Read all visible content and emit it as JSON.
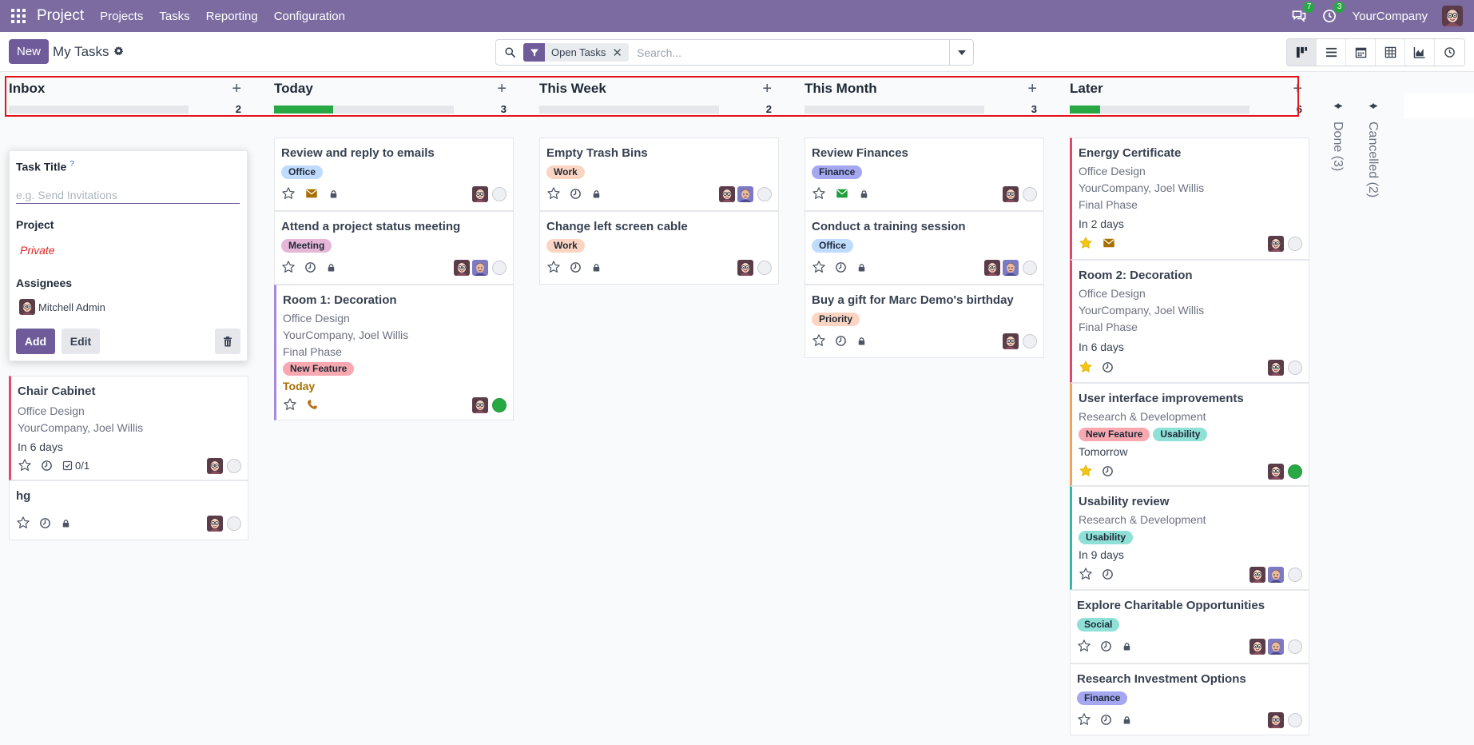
{
  "navbar": {
    "brand": "Project",
    "menu": [
      "Projects",
      "Tasks",
      "Reporting",
      "Configuration"
    ],
    "messages_badge": "7",
    "activities_badge": "3",
    "company": "YourCompany"
  },
  "control": {
    "new_label": "New",
    "breadcrumb": "My Tasks",
    "facet": "Open Tasks",
    "search_placeholder": "Search..."
  },
  "columns": [
    {
      "title": "Inbox",
      "count": "2",
      "progress": 0
    },
    {
      "title": "Today",
      "count": "3",
      "progress": 0.33
    },
    {
      "title": "This Week",
      "count": "2",
      "progress": 0
    },
    {
      "title": "This Month",
      "count": "3",
      "progress": 0
    },
    {
      "title": "Later",
      "count": "6",
      "progress": 0.17
    }
  ],
  "folded": [
    {
      "label": "Done (3)"
    },
    {
      "label": "Cancelled (2)"
    }
  ],
  "quick_create": {
    "task_title_label": "Task Title",
    "help_mark": "?",
    "title_placeholder": "e.g. Send Invitations",
    "project_label": "Project",
    "project_value": "Private",
    "assignees_label": "Assignees",
    "assignee": "Mitchell Admin",
    "add": "Add",
    "edit": "Edit"
  },
  "cards": {
    "inbox": [
      {
        "title": "Chair Cabinet",
        "project": "Office Design",
        "partner": "YourCompany, Joel Willis",
        "date": "In 6 days",
        "subtasks": "0/1"
      },
      {
        "title": "hg"
      }
    ],
    "today": [
      {
        "title": "Review and reply to emails",
        "tags": [
          {
            "name": "Office",
            "color": "#bfdbfe"
          }
        ]
      },
      {
        "title": "Attend a project status meeting",
        "tags": [
          {
            "name": "Meeting",
            "color": "#e6b6d8"
          }
        ]
      },
      {
        "title": "Room 1: Decoration",
        "project": "Office Design",
        "partner": "YourCompany, Joel Willis",
        "stage": "Final Phase",
        "tags": [
          {
            "name": "New Feature",
            "color": "#f9a8b0"
          }
        ],
        "date": "Today"
      }
    ],
    "week": [
      {
        "title": "Empty Trash Bins",
        "tags": [
          {
            "name": "Work",
            "color": "#fcd5c2"
          }
        ]
      },
      {
        "title": "Change left screen cable",
        "tags": [
          {
            "name": "Work",
            "color": "#fcd5c2"
          }
        ]
      }
    ],
    "month": [
      {
        "title": "Review Finances",
        "tags": [
          {
            "name": "Finance",
            "color": "#a5a8f0"
          }
        ]
      },
      {
        "title": "Conduct a training session",
        "tags": [
          {
            "name": "Office",
            "color": "#bfdbfe"
          }
        ]
      },
      {
        "title": "Buy a gift for Marc Demo's birthday",
        "tags": [
          {
            "name": "Priority",
            "color": "#fcd5c2"
          }
        ]
      }
    ],
    "later": [
      {
        "title": "Energy Certificate",
        "project": "Office Design",
        "partner": "YourCompany, Joel Willis",
        "stage": "Final Phase",
        "date": "In 2 days"
      },
      {
        "title": "Room 2: Decoration",
        "project": "Office Design",
        "partner": "YourCompany, Joel Willis",
        "stage": "Final Phase",
        "date": "In 6 days"
      },
      {
        "title": "User interface improvements",
        "project": "Research & Development",
        "tags": [
          {
            "name": "New Feature",
            "color": "#f9a8b0"
          },
          {
            "name": "Usability",
            "color": "#8fe0d6"
          }
        ],
        "date": "Tomorrow"
      },
      {
        "title": "Usability review",
        "project": "Research & Development",
        "tags": [
          {
            "name": "Usability",
            "color": "#8fe0d6"
          }
        ],
        "date": "In 9 days"
      },
      {
        "title": "Explore Charitable Opportunities",
        "tags": [
          {
            "name": "Social",
            "color": "#8fe0d6"
          }
        ]
      },
      {
        "title": "Research Investment Options",
        "tags": [
          {
            "name": "Finance",
            "color": "#a5a8f0"
          }
        ]
      }
    ]
  },
  "colors": {
    "navbar": "#7c6ba0",
    "primary": "#6f5b9a",
    "highlight": "#e3141c",
    "done_green": "#28a745",
    "star_gold": "#f3c614"
  }
}
